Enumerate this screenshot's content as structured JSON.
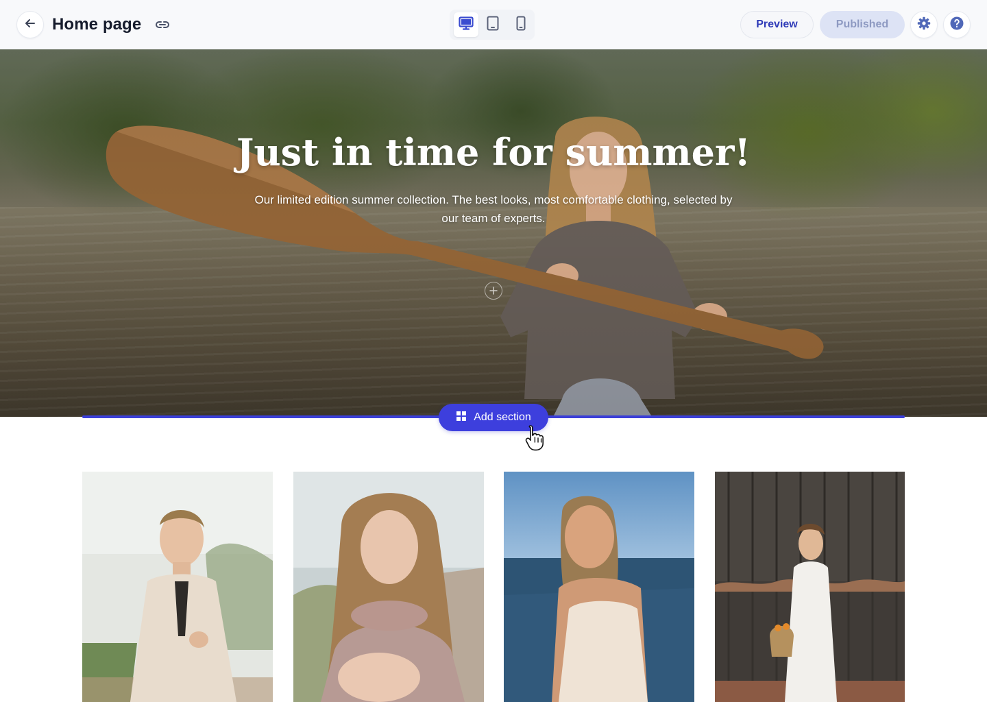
{
  "toolbar": {
    "page_title": "Home page",
    "icons": {
      "back": "arrow-left-icon",
      "link": "link-icon",
      "desktop": "desktop-icon",
      "tablet": "tablet-icon",
      "mobile": "mobile-icon",
      "settings": "gear-icon",
      "help": "question-mark-icon"
    },
    "active_device": "desktop",
    "preview_label": "Preview",
    "published_label": "Published"
  },
  "hero": {
    "title": "Just in time for summer!",
    "subtitle": "Our limited edition summer collection. The best looks, most comfortable clothing, selected by our team of experts."
  },
  "add_section": {
    "label": "Add section",
    "icon": "grid-icon"
  },
  "gallery": {
    "items": [
      {
        "photo": "woman-greenhouse-photo"
      },
      {
        "photo": "woman-pink-sweater-photo"
      },
      {
        "photo": "woman-seaside-photo"
      },
      {
        "photo": "woman-white-dress-photo"
      }
    ]
  },
  "colors": {
    "accent": "#3d3fdd",
    "preview_text": "#2f3bb8",
    "published_bg": "#dde3f5",
    "published_text": "#8e9ac2",
    "icon_blue": "#5068b8"
  }
}
